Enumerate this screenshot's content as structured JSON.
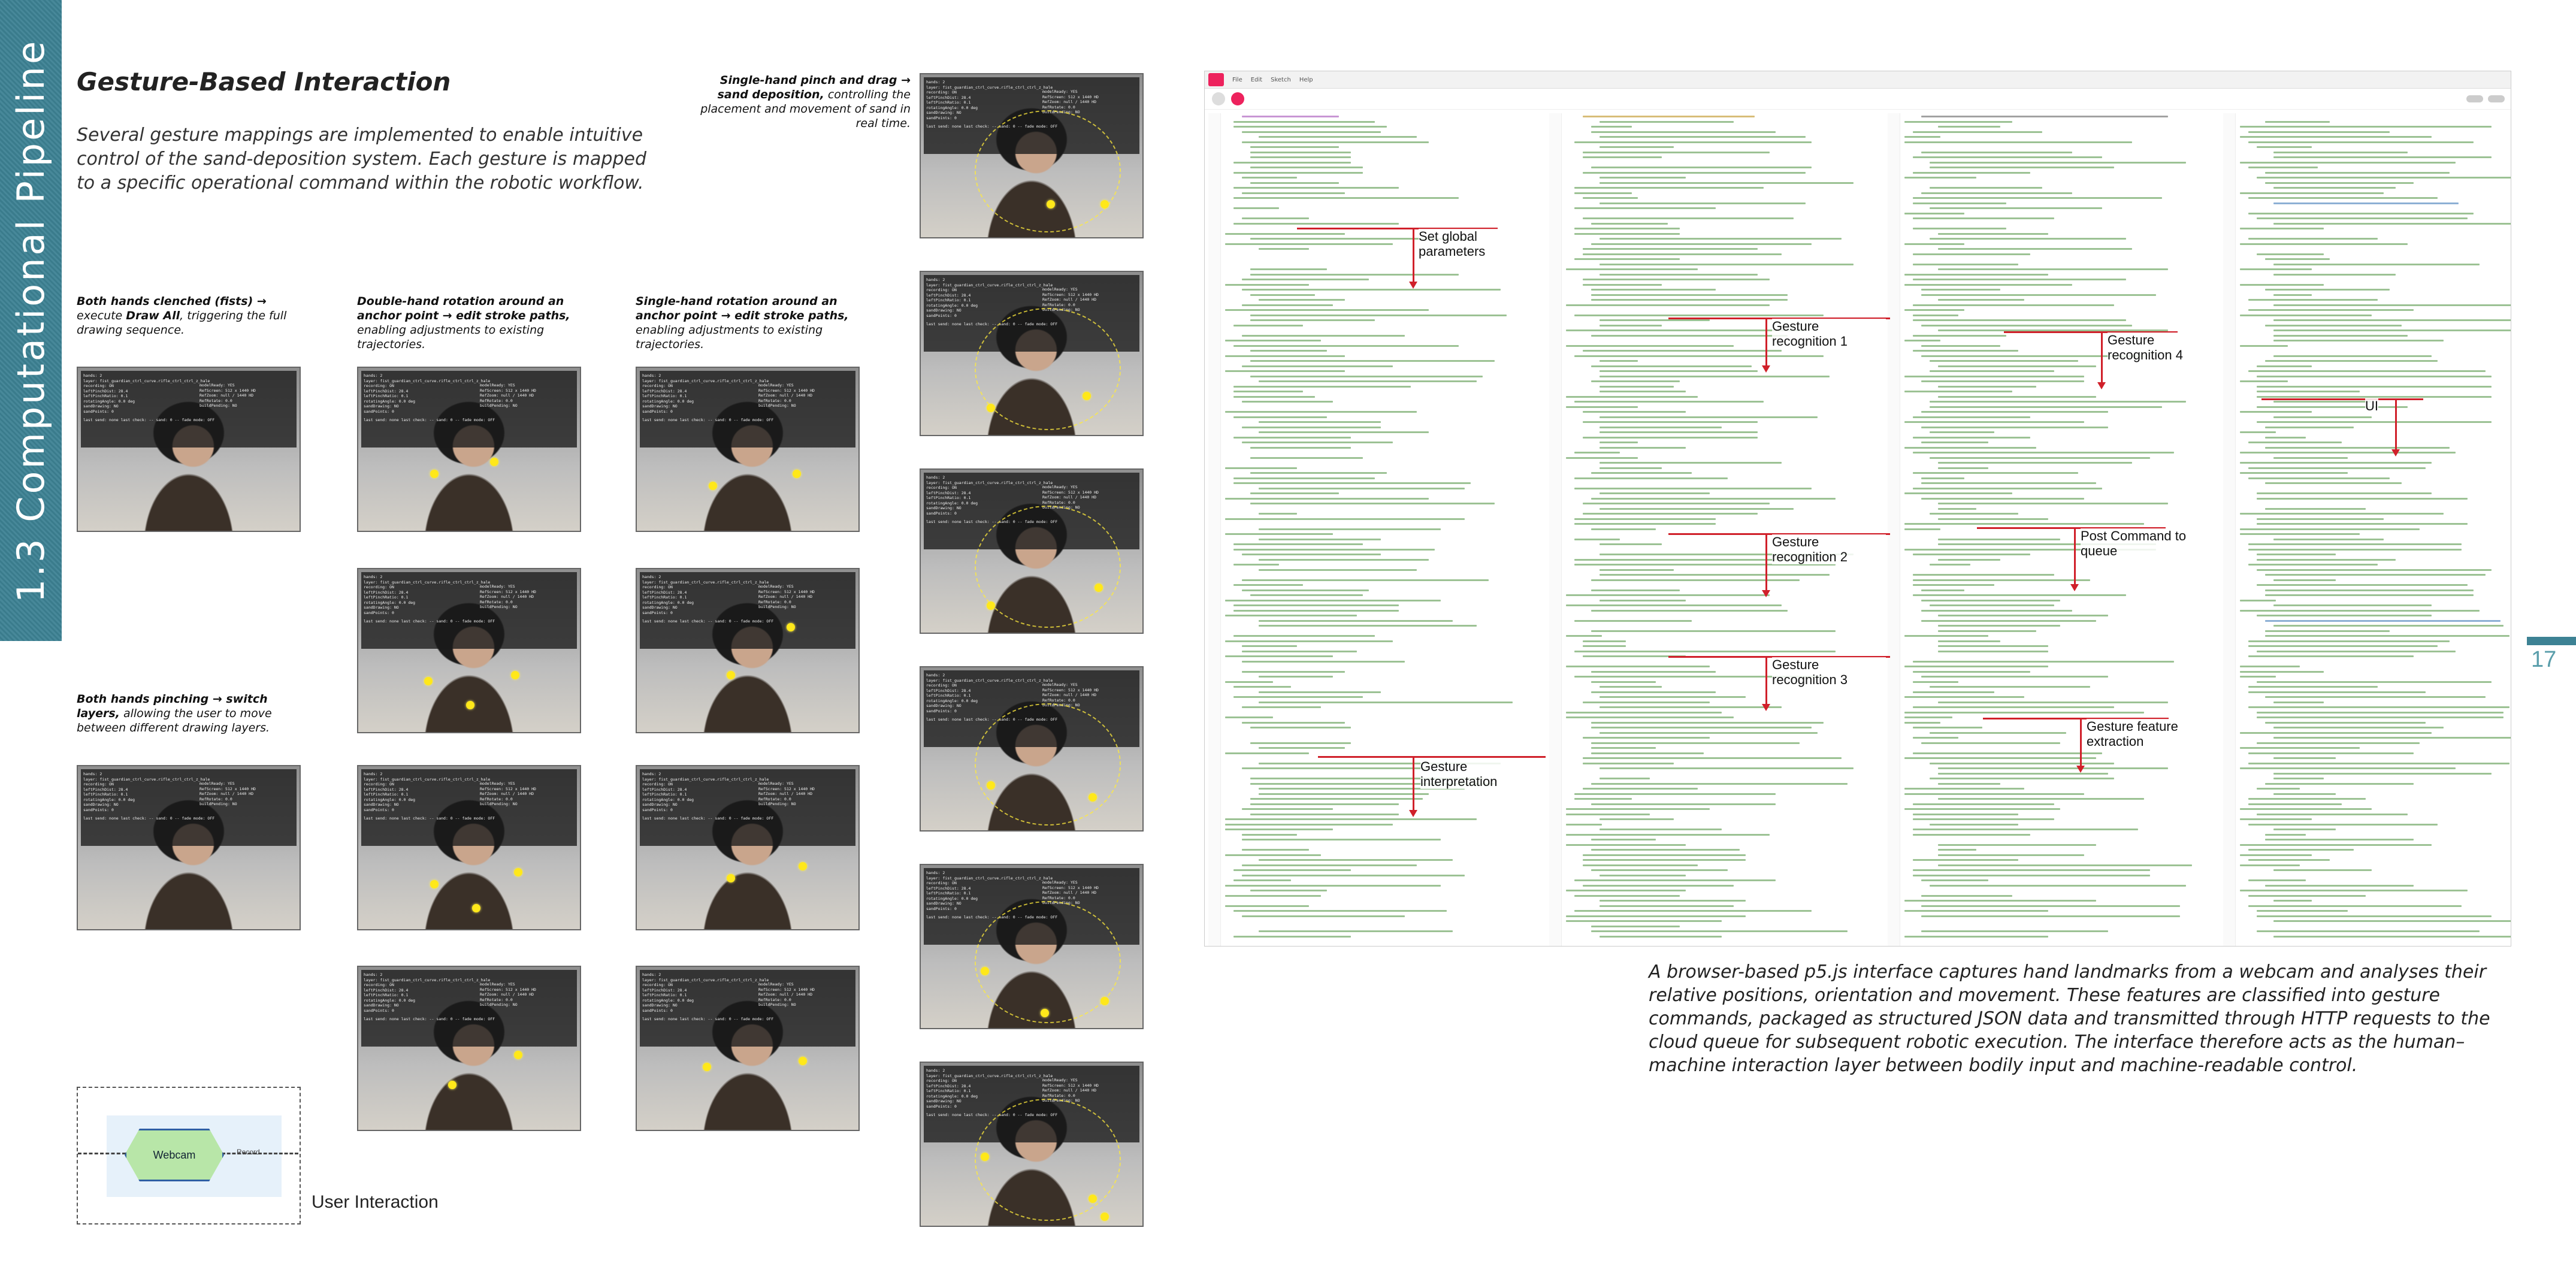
{
  "section_title": "1.3 Computational Pipeline",
  "page_title": "Gesture-Based Interaction",
  "intro": "Several gesture mappings are implemented to enable intuitive control of the sand-deposition system. Each gesture is mapped to a specific operational command within the robotic workflow.",
  "captions": {
    "single_pinch": {
      "bold": "Single-hand pinch and drag → sand deposition,",
      "rest": " controlling the placement and movement of sand in real time."
    },
    "fists": {
      "bold": "Both hands clenched (fists) →",
      "rest": " execute ",
      "bold2": "Draw All",
      "rest2": ", triggering the full drawing sequence."
    },
    "double_rotation": {
      "bold": "Double-hand rotation around an anchor point → edit stroke paths,",
      "rest": " enabling adjustments to existing trajectories."
    },
    "single_rotation": {
      "bold": "Single-hand rotation around an anchor point → edit stroke paths,",
      "rest": " enabling adjustments to existing trajectories."
    },
    "pinch_both": {
      "bold": "Both hands pinching → switch layers,",
      "rest": " allowing the user to move between different drawing layers."
    }
  },
  "frame_hud": {
    "line1": "hands: 2",
    "line2": "layer: fist_guardian_ctrl_curve.rifle_ctrl_ctrl_z_hale",
    "line3": "recording: ON",
    "line4": "modelReady: YES",
    "left_block": "leftPinchDist: 28.4\nleftPinchRatio: 0.1\nrotatingAngle: 0.0 deg\nsandDrawing: NO\nsandPoints: 0",
    "right_block": "RefScreen: 512 x 1440 HD\nRefZoom: null / 1440 HD\nRefRotate: 0.0\nbuildPending: NO",
    "footer": "last send: none last check: -- sand: 0 -- fade mode: OFF"
  },
  "annotations": {
    "set_global": "Set global parameters",
    "gesture_interp": "Gesture interpretation",
    "gr1": "Gesture recognition 1",
    "gr2": "Gesture recognition 2",
    "gr3": "Gesture recognition 3",
    "gr4": "Gesture recognition 4",
    "post_command": "Post Command to queue",
    "feature_extract": "Gesture feature extraction",
    "ui": "UI"
  },
  "bottom_caption": "A browser-based p5.js interface captures hand landmarks from a webcam and analyses their relative positions, orientation and movement. These features are classified into gesture commands, packaged as structured JSON data and transmitted through HTTP requests to the cloud queue for subsequent robotic execution. The interface therefore acts as the human–machine interaction layer between bodily input and machine-readable control.",
  "page_number": "17",
  "diagram": {
    "node": "Webcam",
    "edge": "Record"
  },
  "user_interaction": "User Interaction",
  "editor": {
    "menu": [
      "File",
      "Edit",
      "Sketch",
      "Help"
    ]
  }
}
